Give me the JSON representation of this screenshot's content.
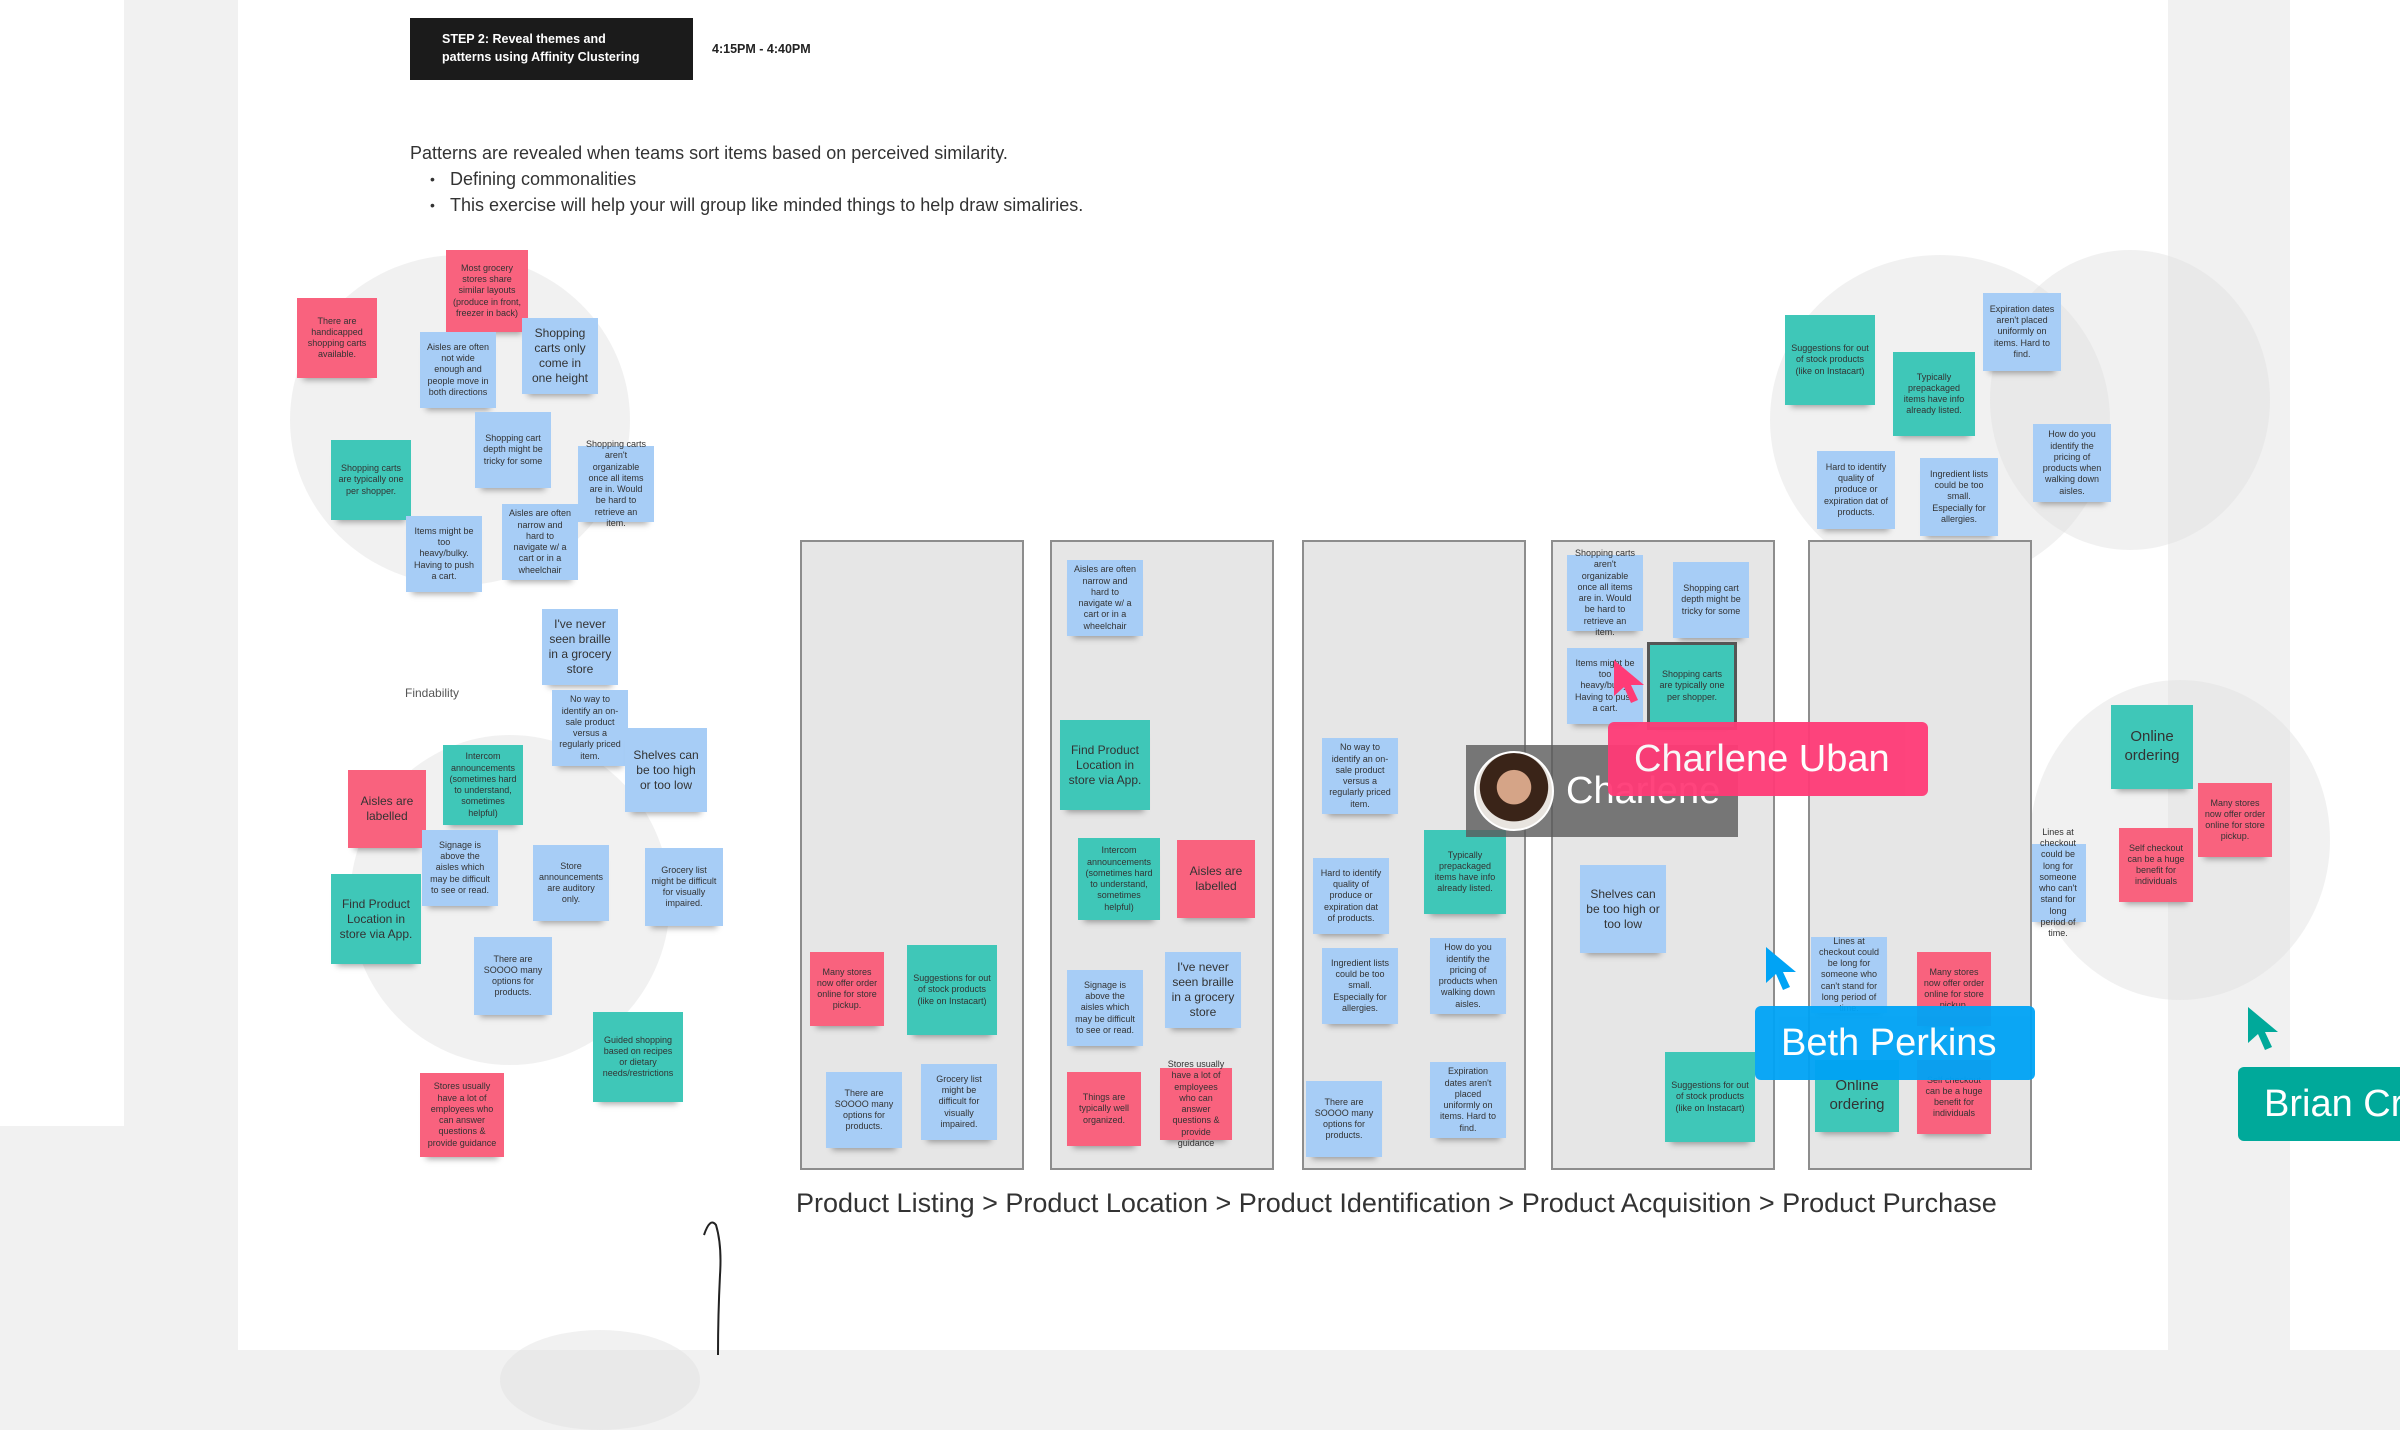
{
  "header": {
    "step_title_line1": "STEP 2: Reveal themes and",
    "step_title_line2": "patterns using Affinity Clustering",
    "time_range": "4:15PM - 4:40PM"
  },
  "intro": {
    "text": "Patterns are revealed when teams sort items based on perceived similarity.",
    "bullets": [
      "Defining commonalities",
      "This exercise will help your will group like minded things to help draw simaliries."
    ]
  },
  "cluster_labels": {
    "findability": "Findability"
  },
  "left_cluster_notes": [
    {
      "text": "There are handicapped shopping carts available.",
      "color": "pink"
    },
    {
      "text": "Most grocery stores share similar layouts (produce in front, freezer in back)",
      "color": "pink"
    },
    {
      "text": "Aisles are often not wide enough and people move in both directions",
      "color": "blue"
    },
    {
      "text": "Shopping carts only come in one height",
      "color": "blue"
    },
    {
      "text": "Shopping cart depth might be tricky for some",
      "color": "blue"
    },
    {
      "text": "Shopping carts are typically one per shopper.",
      "color": "teal"
    },
    {
      "text": "Shopping carts aren't organizable once all items are in. Would be hard to retrieve an item.",
      "color": "blue"
    },
    {
      "text": "Items might be too heavy/bulky. Having to push a cart.",
      "color": "blue"
    },
    {
      "text": "Aisles are often narrow and hard to navigate w/ a cart or in a wheelchair",
      "color": "blue"
    },
    {
      "text": "I've never seen braille in a grocery store",
      "color": "blue"
    },
    {
      "text": "No way to identify an on-sale product versus a regularly priced item.",
      "color": "blue"
    },
    {
      "text": "Shelves can be too high or too low",
      "color": "blue"
    },
    {
      "text": "Intercom announcements (sometimes hard to understand, sometimes helpful)",
      "color": "teal"
    },
    {
      "text": "Aisles are labelled",
      "color": "pink"
    },
    {
      "text": "Signage is above the aisles which may be difficult to see or read.",
      "color": "blue"
    },
    {
      "text": "Store announcements are auditory only.",
      "color": "blue"
    },
    {
      "text": "Grocery list might be difficult for visually impaired.",
      "color": "blue"
    },
    {
      "text": "Find Product Location in store via App.",
      "color": "teal"
    },
    {
      "text": "There are SOOOO many options for products.",
      "color": "blue"
    },
    {
      "text": "Guided shopping based on recipes or dietary needs/restrictions",
      "color": "teal"
    },
    {
      "text": "Stores usually have a lot of employees who can answer questions & provide guidance",
      "color": "pink"
    }
  ],
  "right_cluster_notes": [
    {
      "text": "Suggestions for out of stock products (like on Instacart)",
      "color": "teal"
    },
    {
      "text": "Typically prepackaged items have info already listed.",
      "color": "teal"
    },
    {
      "text": "Expiration dates aren't placed uniformly on items. Hard to find.",
      "color": "blue"
    },
    {
      "text": "Hard to identify quality of produce or expiration dat of products.",
      "color": "blue"
    },
    {
      "text": "Ingredient lists could be too small. Especially for allergies.",
      "color": "blue"
    },
    {
      "text": "How do you identify the pricing of products when walking down aisles.",
      "color": "blue"
    }
  ],
  "far_right_notes": [
    {
      "text": "Online ordering",
      "color": "teal"
    },
    {
      "text": "Many stores now offer order online for store pickup.",
      "color": "pink"
    },
    {
      "text": "Self checkout can be a huge benefit for individuals",
      "color": "pink"
    },
    {
      "text": "Lines at checkout could be long for someone who can't stand for long period of time.",
      "color": "blue"
    }
  ],
  "columns": [
    {
      "name": "Product Listing",
      "notes": [
        {
          "text": "Many stores now offer order online for store pickup.",
          "color": "pink"
        },
        {
          "text": "Suggestions for out of stock products (like on Instacart)",
          "color": "teal"
        },
        {
          "text": "There are SOOOO many options for products.",
          "color": "blue"
        },
        {
          "text": "Grocery list might be difficult for visually impaired.",
          "color": "blue"
        }
      ]
    },
    {
      "name": "Product Location",
      "notes": [
        {
          "text": "Aisles are often narrow and hard to navigate w/ a cart or in a wheelchair",
          "color": "blue"
        },
        {
          "text": "Find Product Location in store via App.",
          "color": "teal"
        },
        {
          "text": "Intercom announcements (sometimes hard to understand, sometimes helpful)",
          "color": "teal"
        },
        {
          "text": "Aisles are labelled",
          "color": "pink"
        },
        {
          "text": "Signage is above the aisles which may be difficult to see or read.",
          "color": "blue"
        },
        {
          "text": "I've never seen braille in a grocery store",
          "color": "blue"
        },
        {
          "text": "Things are typically well organized.",
          "color": "pink"
        },
        {
          "text": "Stores usually have a lot of employees who can answer questions & provide guidance",
          "color": "pink"
        }
      ]
    },
    {
      "name": "Product Identification",
      "notes": [
        {
          "text": "No way to identify an on-sale product versus a regularly priced item.",
          "color": "blue"
        },
        {
          "text": "Typically prepackaged items have info already listed.",
          "color": "teal"
        },
        {
          "text": "Hard to identify quality of produce or expiration dat of products.",
          "color": "blue"
        },
        {
          "text": "Ingredient lists could be too small. Especially for allergies.",
          "color": "blue"
        },
        {
          "text": "How do you identify the pricing of products when walking down aisles.",
          "color": "blue"
        },
        {
          "text": "There are SOOOO many options for products.",
          "color": "blue"
        },
        {
          "text": "Expiration dates aren't placed uniformly on items. Hard to find.",
          "color": "blue"
        }
      ]
    },
    {
      "name": "Product Acquisition",
      "notes": [
        {
          "text": "Shopping carts aren't organizable once all items are in. Would be hard to retrieve an item.",
          "color": "blue"
        },
        {
          "text": "Shopping cart depth might be tricky for some",
          "color": "blue"
        },
        {
          "text": "Items might be too heavy/bulky. Having to push a cart.",
          "color": "blue"
        },
        {
          "text": "Shopping carts are typically one per shopper.",
          "color": "teal"
        },
        {
          "text": "Shelves can be too high or too low",
          "color": "blue"
        },
        {
          "text": "Suggestions for out of stock products (like on Instacart)",
          "color": "teal"
        }
      ]
    },
    {
      "name": "Product Purchase",
      "notes": [
        {
          "text": "Lines at checkout could be long for someone who can't stand for long period of time.",
          "color": "blue"
        },
        {
          "text": "Many stores now offer order online for store pickup.",
          "color": "pink"
        },
        {
          "text": "Online ordering",
          "color": "teal"
        },
        {
          "text": "Self checkout can be a huge benefit for individuals",
          "color": "pink"
        }
      ]
    }
  ],
  "flow_label": "Product Listing > Product Location > Product Identification > Product Acquisition > Product Purchase",
  "collaborators": {
    "presence_name": "Charlene",
    "cursors": [
      {
        "name": "Charlene Uban",
        "color": "#ff3b77"
      },
      {
        "name": "Beth Perkins",
        "color": "#00a3f5"
      },
      {
        "name": "Brian Cr",
        "color": "#00a99a"
      }
    ]
  },
  "colors": {
    "sticky_blue": "#a7cdf6",
    "sticky_teal": "#3fc7b8",
    "sticky_pink": "#f9627e",
    "column_bg": "#e6e6e6"
  }
}
